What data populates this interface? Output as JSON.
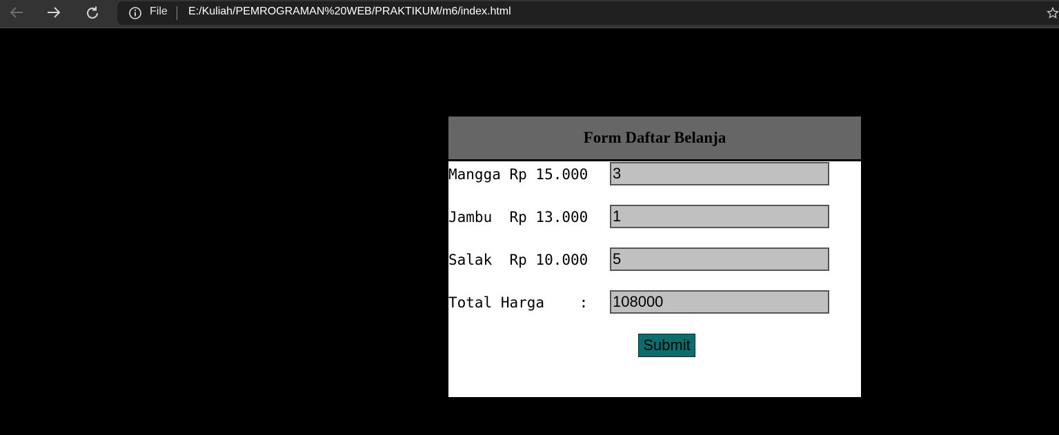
{
  "browser": {
    "back_icon": "arrow-left-icon",
    "forward_icon": "arrow-right-icon",
    "refresh_icon": "refresh-icon",
    "info_icon": "info-icon",
    "scheme_label": "File",
    "url": "E:/Kuliah/PEMROGRAMAN%20WEB/PRAKTIKUM/m6/index.html",
    "favorite_icon": "star-icon"
  },
  "form": {
    "title": "Form Daftar Belanja",
    "rows": [
      {
        "label": "Mangga Rp 15.000",
        "value": "3"
      },
      {
        "label": "Jambu  Rp 13.000",
        "value": "1"
      },
      {
        "label": "Salak  Rp 10.000",
        "value": "5"
      },
      {
        "label": "Total Harga    :",
        "value": "108000"
      }
    ],
    "submit_label": "Submit"
  },
  "colors": {
    "page_background": "#000000",
    "header_background": "#666666",
    "field_background": "#c0c0c0",
    "submit_background": "#0b6e6e"
  }
}
